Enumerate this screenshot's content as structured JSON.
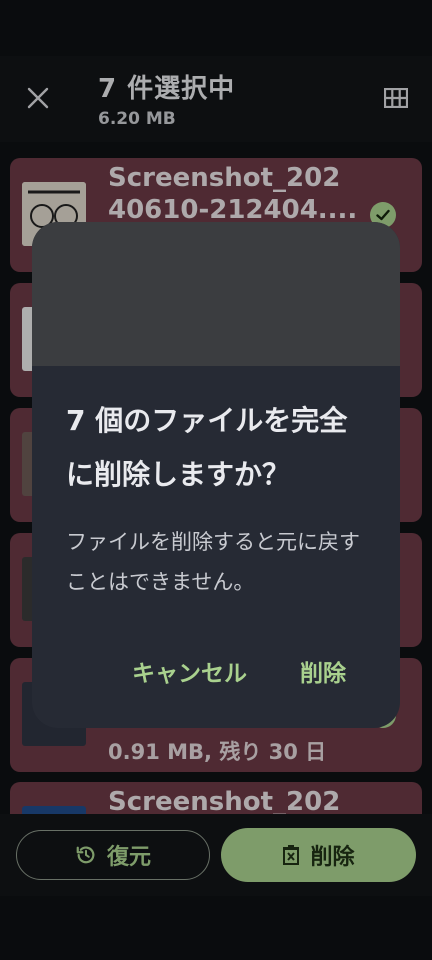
{
  "header": {
    "title": "7 件選択中",
    "subtitle": "6.20 MB",
    "close_icon": "close-icon",
    "grid_icon": "grid-view-icon"
  },
  "list": {
    "items": [
      {
        "title_line1": "Screenshot_202",
        "title_line2": "40610-212404....",
        "meta": ""
      },
      {
        "title_line1": "",
        "title_line2": "",
        "meta": ""
      },
      {
        "title_line1": "",
        "title_line2": "",
        "meta": ""
      },
      {
        "title_line1": "",
        "title_line2": "",
        "meta": ""
      },
      {
        "title_line1": "",
        "title_line2": "",
        "meta": "0.91 MB, 残り 30 日"
      },
      {
        "title_line1": "Screenshot_202",
        "title_line2": "",
        "meta": ""
      }
    ]
  },
  "dialog": {
    "title": "7 個のファイルを完全に削除しますか？",
    "body": "ファイルを削除すると元に戻すことはできません。",
    "cancel_label": "キャンセル",
    "confirm_label": "削除"
  },
  "bottom_bar": {
    "restore_label": "復元",
    "delete_label": "削除"
  },
  "colors": {
    "accent": "#a9d18e",
    "row_background": "#6a3945",
    "dialog_background": "#262a34"
  }
}
